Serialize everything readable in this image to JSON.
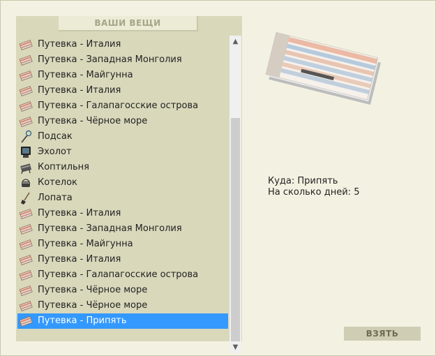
{
  "panel": {
    "title": "ВАШИ ВЕЩИ"
  },
  "items": [
    {
      "label": "Путевка - Италия",
      "icon": "ticket-icon"
    },
    {
      "label": "Путевка - Западная Монголия",
      "icon": "ticket-icon"
    },
    {
      "label": "Путевка - Майгунна",
      "icon": "ticket-icon"
    },
    {
      "label": "Путевка - Италия",
      "icon": "ticket-icon"
    },
    {
      "label": "Путевка - Галапагосские острова",
      "icon": "ticket-icon"
    },
    {
      "label": "Путевка - Чёрное море",
      "icon": "ticket-icon"
    },
    {
      "label": "Подсак",
      "icon": "landing-net-icon"
    },
    {
      "label": "Эхолот",
      "icon": "echo-sounder-icon"
    },
    {
      "label": "Коптильня",
      "icon": "smokehouse-icon"
    },
    {
      "label": "Котелок",
      "icon": "pot-icon"
    },
    {
      "label": "Лопата",
      "icon": "shovel-icon"
    },
    {
      "label": "Путевка - Италия",
      "icon": "ticket-icon"
    },
    {
      "label": "Путевка - Западная Монголия",
      "icon": "ticket-icon"
    },
    {
      "label": "Путевка - Майгунна",
      "icon": "ticket-icon"
    },
    {
      "label": "Путевка - Италия",
      "icon": "ticket-icon"
    },
    {
      "label": "Путевка - Галапагосские острова",
      "icon": "ticket-icon"
    },
    {
      "label": "Путевка - Чёрное море",
      "icon": "ticket-icon"
    },
    {
      "label": "Путевка - Чёрное море",
      "icon": "ticket-icon"
    },
    {
      "label": "Путевка - Припять",
      "icon": "ticket-icon",
      "selected": true
    }
  ],
  "details": {
    "destination_label": "Куда:",
    "destination_value": "Припять",
    "days_label": "На сколько дней:",
    "days_value": "5"
  },
  "take_button": {
    "label": "ВЗЯТЬ"
  },
  "colors": {
    "selection": "#3399ff",
    "panel": "#d9d8bb",
    "background": "#f3f2e2"
  }
}
